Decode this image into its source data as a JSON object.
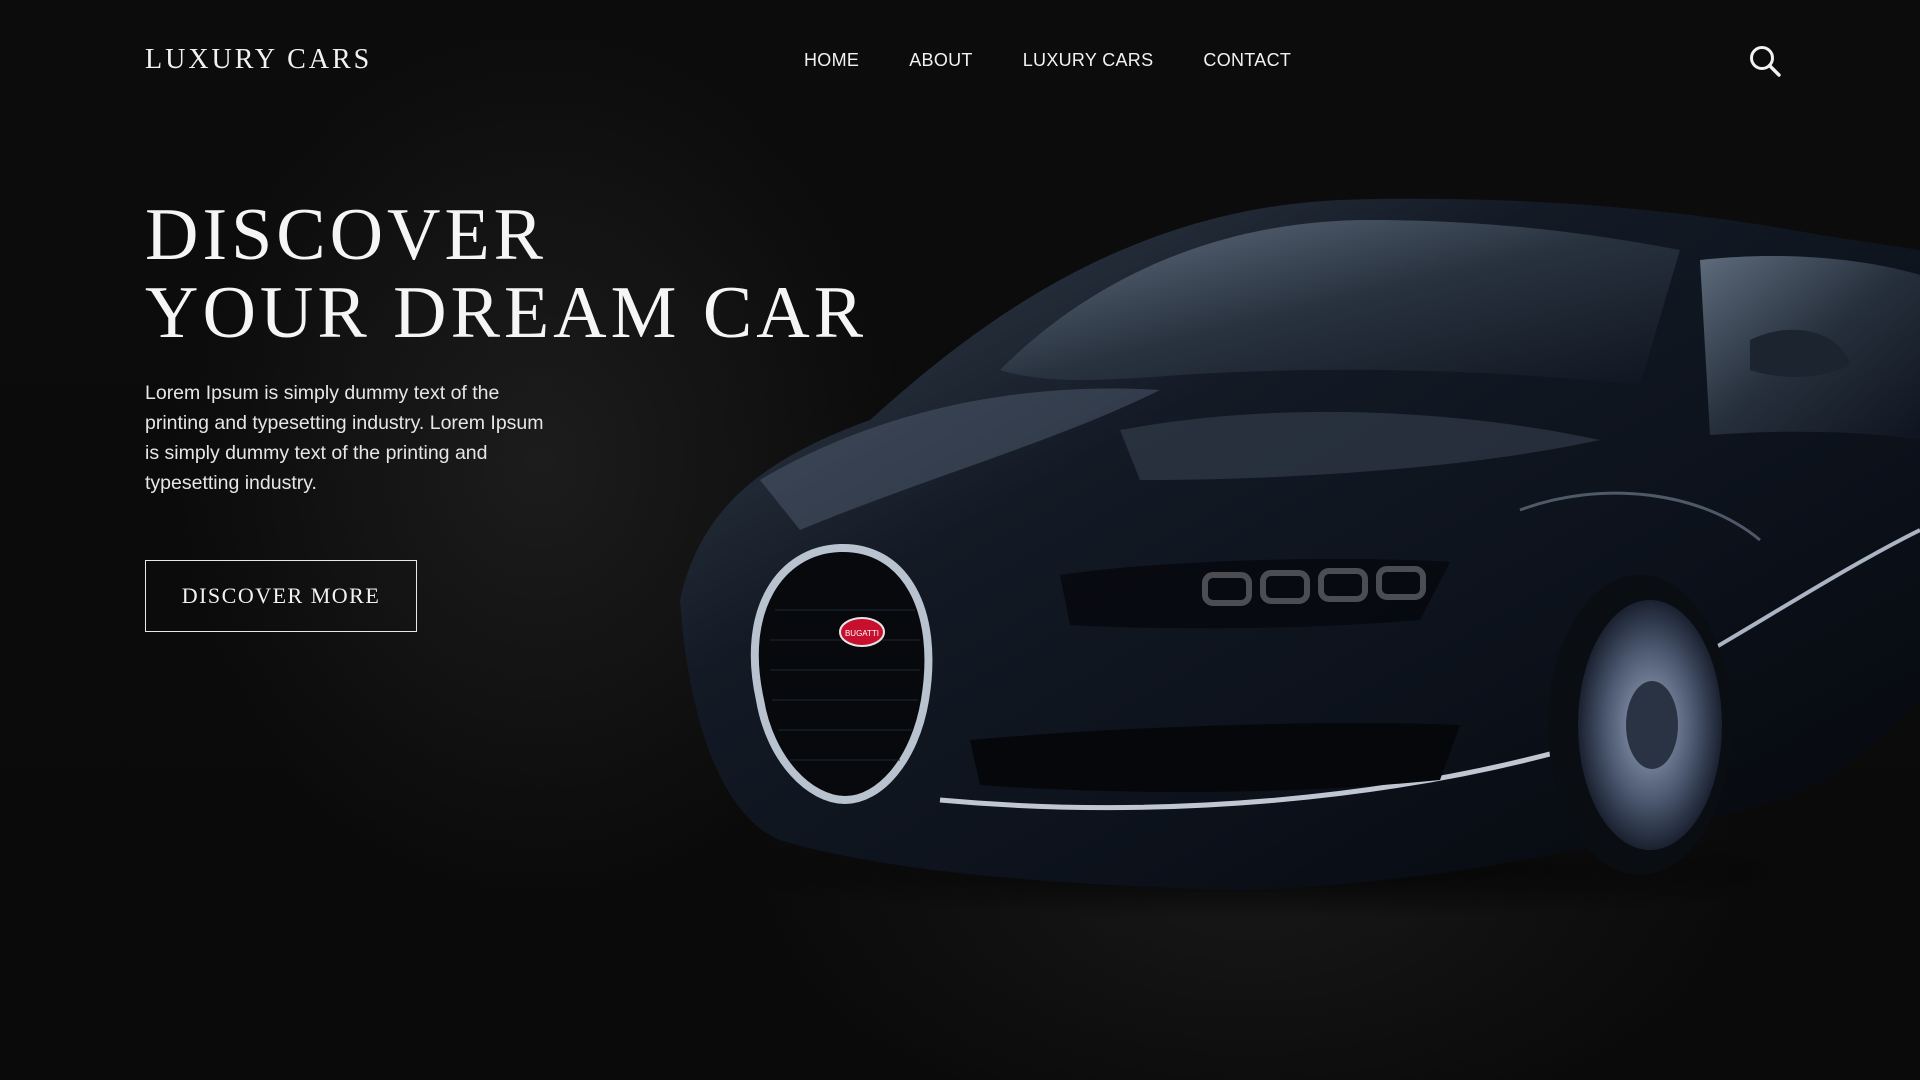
{
  "header": {
    "logo": "LUXURY CARS",
    "nav": [
      "HOME",
      "ABOUT",
      "LUXURY CARS",
      "CONTACT"
    ],
    "search_icon": "search-icon"
  },
  "hero": {
    "title_line1": "DISCOVER",
    "title_line2": "YOUR DREAM CAR",
    "description": "Lorem Ipsum is simply dummy text of the printing and typesetting industry. Lorem Ipsum is simply dummy text of the printing and typesetting industry.",
    "cta_label": "DISCOVER MORE"
  },
  "car": {
    "badge_text": "BUGATTI",
    "body_color": "#0d1522",
    "accent_color": "#c8102e"
  }
}
